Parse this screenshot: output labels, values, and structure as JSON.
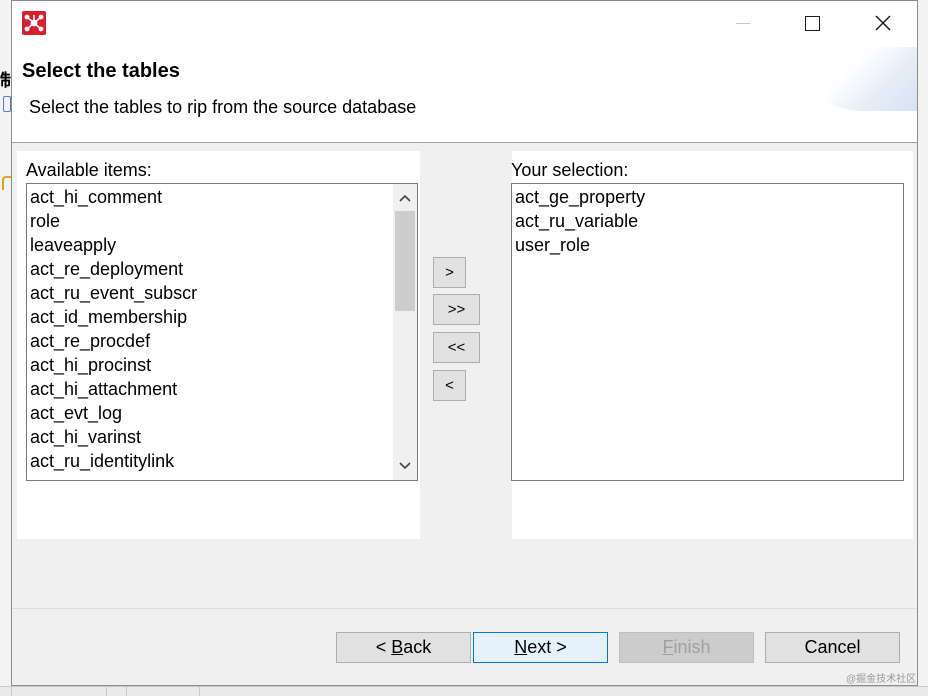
{
  "dialog": {
    "header": {
      "title": "Select the tables",
      "description": "Select the tables to rip from the source database"
    },
    "available": {
      "label": "Available items:",
      "items": [
        "act_hi_comment",
        "role",
        "leaveapply",
        "act_re_deployment",
        "act_ru_event_subscr",
        "act_id_membership",
        "act_re_procdef",
        "act_hi_procinst",
        "act_hi_attachment",
        "act_evt_log",
        "act_hi_varinst",
        "act_ru_identitylink"
      ],
      "scroll_up_glyph": "⌃",
      "scroll_down_glyph": "⌄"
    },
    "selection": {
      "label": "Your selection:",
      "items": [
        "act_ge_property",
        "act_ru_variable",
        "user_role"
      ]
    },
    "move_buttons": {
      "add": ">",
      "add_all": ">>",
      "remove_all": "<<",
      "remove": "<"
    },
    "buttons": {
      "back_prefix": "< ",
      "back_mnemonic": "B",
      "back_rest": "ack",
      "next_mnemonic": "N",
      "next_rest": "ext >",
      "finish_mnemonic": "F",
      "finish_rest": "inish",
      "cancel": "Cancel"
    },
    "window_controls": {
      "close_glyph": "✕"
    }
  },
  "background": {
    "glyph": "制"
  },
  "watermark": "@掘金技术社区",
  "colors": {
    "accent": "#0078d7",
    "app_icon": "#d8202c",
    "scroll_thumb": "#cdcdcd",
    "disabled_button": "#cccccc"
  },
  "icons": {
    "app": "network-node-icon",
    "minimize": "minimize-icon",
    "maximize": "maximize-icon",
    "close": "close-icon"
  }
}
